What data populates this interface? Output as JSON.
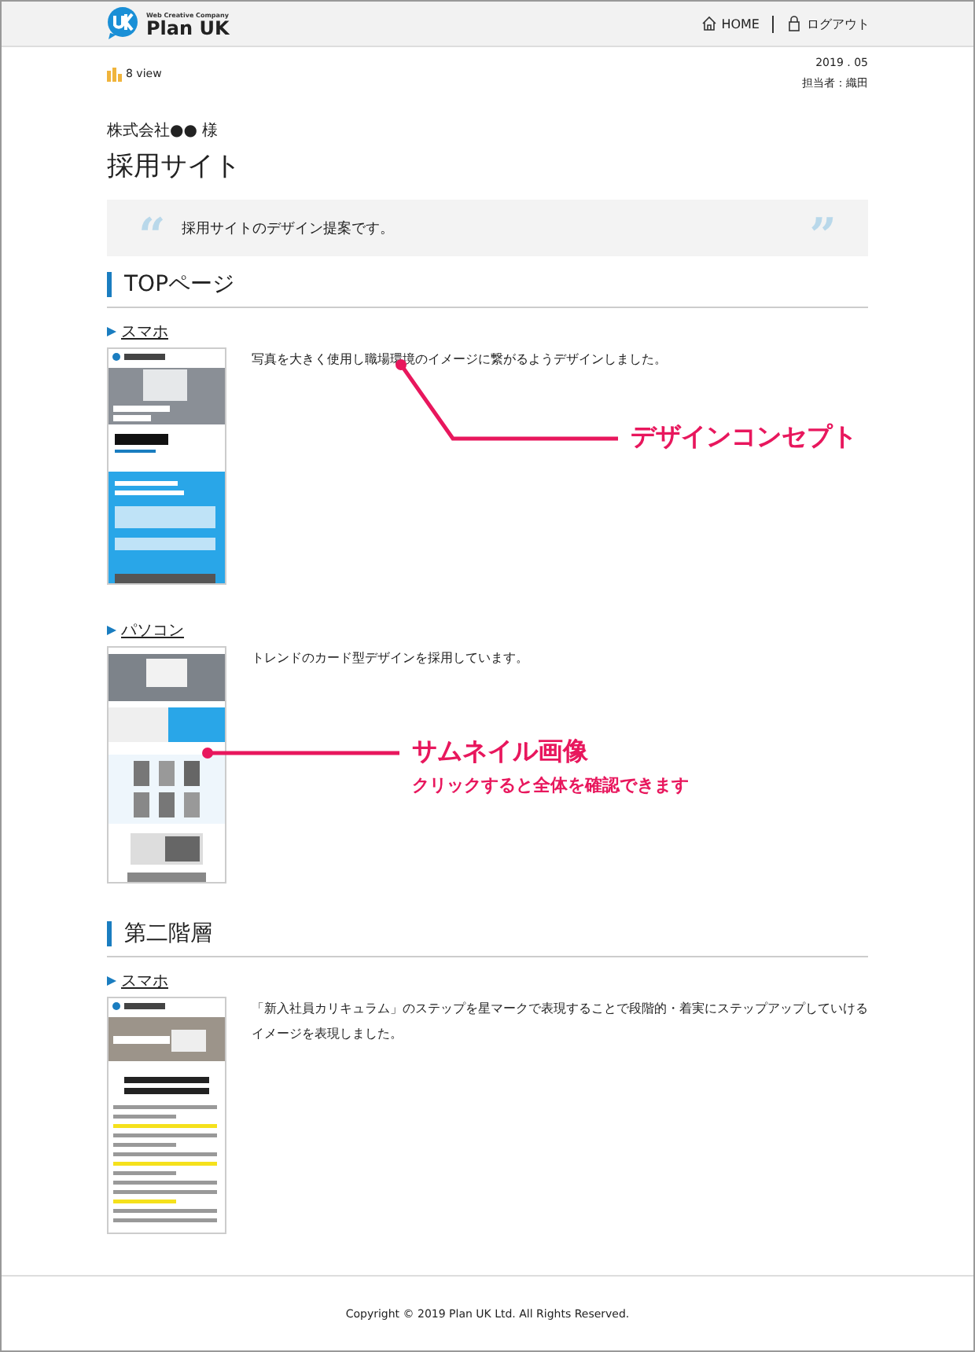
{
  "header": {
    "logo": {
      "tagline": "Web Creative Company",
      "name": "Plan UK"
    },
    "nav": [
      {
        "kind": "home",
        "label": "HOME"
      },
      {
        "kind": "lock",
        "label": "ログアウト"
      }
    ]
  },
  "meta": {
    "views": "8 view",
    "date": "2019 . 05",
    "person": "担当者：織田"
  },
  "client": "株式会社●● 様",
  "title": "採用サイト",
  "quote": {
    "open": "“",
    "text": "採用サイトのデザイン提案です。",
    "close": "”"
  },
  "sections": [
    {
      "heading": "TOPページ",
      "items": [
        {
          "device": "スマホ",
          "description": "写真を大きく使用し職場環境のイメージに繋がるようデザインしました。",
          "kind": "sp-top"
        },
        {
          "device": "パソコン",
          "description": "トレンドのカード型デザインを採用しています。",
          "kind": "pc-top"
        }
      ]
    },
    {
      "heading": "第二階層",
      "items": [
        {
          "device": "スマホ",
          "description": "「新入社員カリキュラム」のステップを星マークで表現することで段階的・着実にステップアップしていけるイメージを表現しました。",
          "kind": "sp-page"
        }
      ]
    }
  ],
  "annotations": [
    {
      "title": "デザインコンセプト"
    },
    {
      "title": "サムネイル画像",
      "subtitle": "クリックすると全体を確認できます"
    }
  ],
  "footer": "Copyright © 2019 Plan UK Ltd. All Rights Reserved."
}
